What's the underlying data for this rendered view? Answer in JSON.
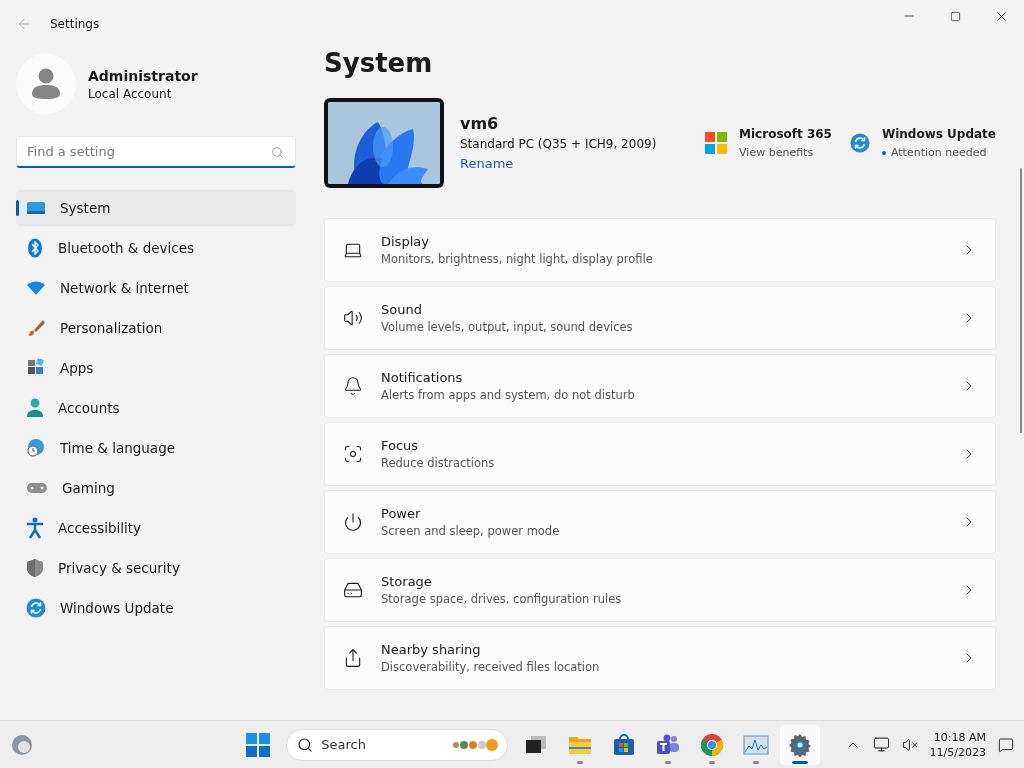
{
  "window": {
    "title": "Settings"
  },
  "user": {
    "name": "Administrator",
    "account": "Local Account"
  },
  "search": {
    "placeholder": "Find a setting"
  },
  "nav": [
    {
      "kind": "system",
      "label": "System",
      "selected": true
    },
    {
      "kind": "bluetooth",
      "label": "Bluetooth & devices",
      "selected": false
    },
    {
      "kind": "network",
      "label": "Network & internet",
      "selected": false
    },
    {
      "kind": "personalization",
      "label": "Personalization",
      "selected": false
    },
    {
      "kind": "apps",
      "label": "Apps",
      "selected": false
    },
    {
      "kind": "accounts",
      "label": "Accounts",
      "selected": false
    },
    {
      "kind": "time",
      "label": "Time & language",
      "selected": false
    },
    {
      "kind": "gaming",
      "label": "Gaming",
      "selected": false
    },
    {
      "kind": "accessibility",
      "label": "Accessibility",
      "selected": false
    },
    {
      "kind": "privacy",
      "label": "Privacy & security",
      "selected": false
    },
    {
      "kind": "update",
      "label": "Windows Update",
      "selected": false
    }
  ],
  "page_title": "System",
  "device": {
    "name": "vm6",
    "model": "Standard PC (Q35 + ICH9, 2009)",
    "rename": "Rename"
  },
  "promos": [
    {
      "kind": "office",
      "title": "Microsoft 365",
      "subtitle": "View benefits"
    },
    {
      "kind": "update",
      "title": "Windows Update",
      "subtitle": "Attention needed"
    }
  ],
  "cards": [
    {
      "kind": "display",
      "title": "Display",
      "subtitle": "Monitors, brightness, night light, display profile"
    },
    {
      "kind": "sound",
      "title": "Sound",
      "subtitle": "Volume levels, output, input, sound devices"
    },
    {
      "kind": "notifications",
      "title": "Notifications",
      "subtitle": "Alerts from apps and system, do not disturb"
    },
    {
      "kind": "focus",
      "title": "Focus",
      "subtitle": "Reduce distractions"
    },
    {
      "kind": "power",
      "title": "Power",
      "subtitle": "Screen and sleep, power mode"
    },
    {
      "kind": "storage",
      "title": "Storage",
      "subtitle": "Storage space, drives, configuration rules"
    },
    {
      "kind": "sharing",
      "title": "Nearby sharing",
      "subtitle": "Discoverability, received files location"
    }
  ],
  "taskbar": {
    "search_placeholder": "Search",
    "time": "10:18 AM",
    "date": "11/5/2023",
    "apps": [
      {
        "kind": "start",
        "running": false,
        "selected": false
      },
      {
        "kind": "search"
      },
      {
        "kind": "taskview",
        "running": false,
        "selected": false
      },
      {
        "kind": "files",
        "running": true,
        "selected": false
      },
      {
        "kind": "store",
        "running": false,
        "selected": false
      },
      {
        "kind": "teams",
        "running": true,
        "selected": false
      },
      {
        "kind": "chrome",
        "running": true,
        "selected": false
      },
      {
        "kind": "monitor",
        "running": true,
        "selected": false
      },
      {
        "kind": "settings",
        "running": true,
        "selected": true
      }
    ]
  }
}
